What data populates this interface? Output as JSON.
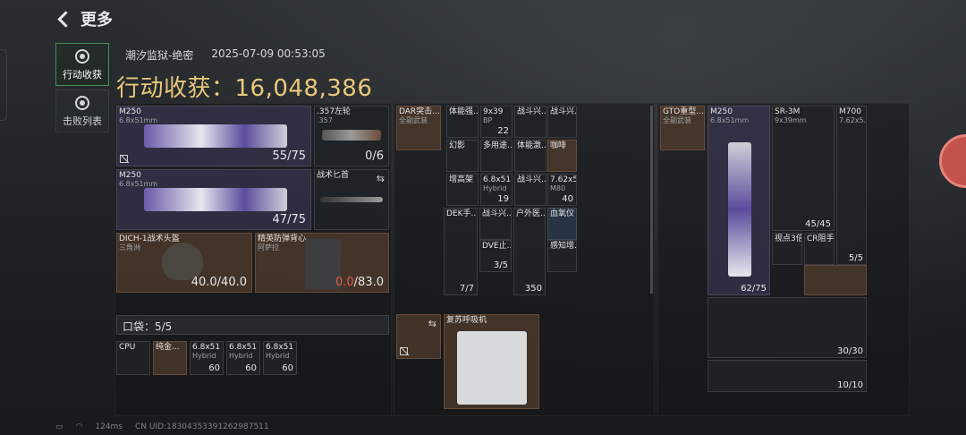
{
  "header": {
    "title": "更多"
  },
  "sidebar": {
    "items": [
      {
        "label": "行动收获"
      },
      {
        "label": "击败列表"
      }
    ]
  },
  "summary": {
    "map": "潮汐监狱-绝密",
    "datetime": "2025-07-09 00:53:05",
    "loot_label": "行动收获：",
    "loot_value": "16,048,386"
  },
  "gear": {
    "primary1": {
      "name": "M250",
      "caliber": "6.8x51mm",
      "ammo": "55/75"
    },
    "pistol": {
      "name": ".357左轮",
      "caliber": ".357",
      "ammo": "0/6"
    },
    "primary2": {
      "name": "M250",
      "caliber": "6.8x51mm",
      "ammo": "47/75"
    },
    "melee": {
      "name": "战术匕首"
    },
    "helmet": {
      "name": "DICH-1战术头盔",
      "source": "三角洲",
      "durability": "40.0/40.0"
    },
    "armor": {
      "name": "精英防弹背心",
      "source": "阿萨拉",
      "durability_current": "0.0",
      "durability_max": "/83.0"
    }
  },
  "pocket": {
    "label": "口袋：5/5",
    "items": [
      {
        "name": "CPU",
        "sub": "",
        "count": ""
      },
      {
        "name": "纯金...",
        "sub": "",
        "count": ""
      },
      {
        "name": "6.8x51",
        "sub": "Hybrid",
        "count": "60"
      },
      {
        "name": "6.8x51",
        "sub": "Hybrid",
        "count": "60"
      },
      {
        "name": "6.8x51",
        "sub": "Hybrid",
        "count": "60"
      }
    ]
  },
  "rig": {
    "name": "DAR突击...",
    "sub": "全副武装",
    "items": [
      {
        "name": "体能强..."
      },
      {
        "name": "9x39",
        "sub": "BP",
        "count": "22"
      },
      {
        "name": "战斗兴..."
      },
      {
        "name": "战斗兴..."
      },
      {
        "name": "幻影"
      },
      {
        "name": "多用途..."
      },
      {
        "name": "体能激..."
      },
      {
        "name": "咖啡"
      },
      {
        "name": "增高架"
      },
      {
        "name": "6.8x51",
        "sub": "Hybrid",
        "count": "19"
      },
      {
        "name": "战斗兴..."
      },
      {
        "name": "7.62x5...",
        "sub": "M80",
        "count": "40"
      }
    ]
  },
  "backpack_items": [
    {
      "name": "DEK手...",
      "count": "7/7"
    },
    {
      "name": "战斗兴..."
    },
    {
      "name": "户外医...",
      "count": "350"
    },
    {
      "name": "血氧仪"
    },
    {
      "name": "DVE止...",
      "count": "3/5"
    },
    {
      "name": "感知增..."
    }
  ],
  "special": {
    "name": "复苏呼吸机"
  },
  "backpack": {
    "name": "GTO重型...",
    "sub": "全副武装"
  },
  "bag_items": [
    {
      "name": "M250",
      "sub": "6.8x51mm",
      "count": "62/75"
    },
    {
      "name": "SR-3M",
      "sub": "9x39mm",
      "count": "45/45"
    },
    {
      "name": "M700",
      "sub": "7.62x5...",
      "count": "5/5"
    },
    {
      "name": "视点3倍"
    },
    {
      "name": "CR阻手..."
    },
    {
      "name": "",
      "count": "30/30"
    },
    {
      "name": "",
      "count": "10/10"
    }
  ],
  "status": {
    "ping": "124ms",
    "uid": "CN UID:18304353391262987511"
  },
  "colors": {
    "accent_gold": "#e9c77a",
    "warn_red": "#e35b4e",
    "active_green": "#4b8a5d"
  }
}
